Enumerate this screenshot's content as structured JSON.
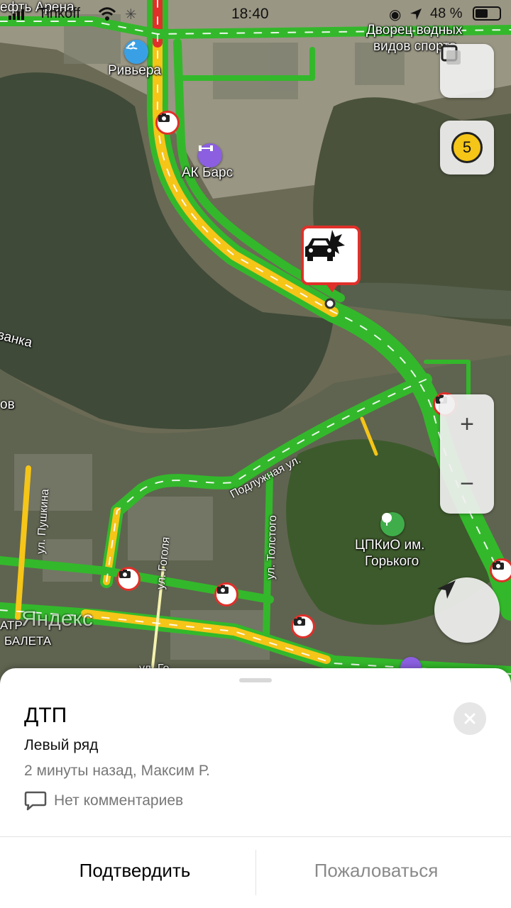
{
  "status_bar": {
    "carrier": "Tinkoff",
    "time": "18:40",
    "battery": "48 %"
  },
  "map": {
    "labels": {
      "arena": "ефть Арена",
      "riviera": "Ривьера",
      "ak_bars": "АК Барс",
      "palace_line1": "Дворец водных",
      "palace_line2": "видов спорта",
      "river": "занка",
      "river_left": "ов",
      "podluzhnaya": "Подлужная ул.",
      "pushkina": "ул. Пушкина",
      "gogolya": "ул. Гоголя",
      "tolstogo": "ул. Толстого",
      "gorky_line1": "ЦПКиО им.",
      "gorky_line2": "Горького",
      "ballet_line1": "АТР",
      "ballet_line2": "БАЛЕТА",
      "yandex_watermark": "Яндекс",
      "bottom_street": "ул. Го"
    },
    "traffic_score": "5",
    "incident_icon": "car-crash-icon"
  },
  "controls": {
    "layers_icon": "layers-icon",
    "zoom_in": "+",
    "zoom_out": "−",
    "locate_icon": "navigation-arrow-icon"
  },
  "incident": {
    "title": "ДТП",
    "lane": "Левый ряд",
    "meta": "2 минуты назад, Максим Р.",
    "comments": "Нет комментариев",
    "confirm": "Подтвердить",
    "report": "Пожаловаться"
  },
  "colors": {
    "traffic_green": "#33b82b",
    "traffic_yellow": "#f5c518",
    "traffic_red": "#e0302a",
    "water": "#3f4a39"
  }
}
